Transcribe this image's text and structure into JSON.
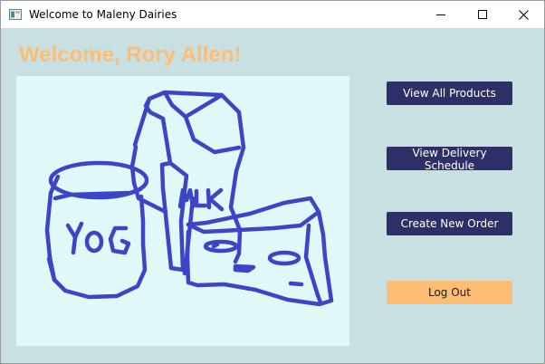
{
  "window": {
    "title": "Welcome to Maleny Dairies",
    "controls": [
      "minimize-icon",
      "maximize-icon",
      "close-icon"
    ]
  },
  "welcome_text": "Welcome, Rory Allen!",
  "illustration": {
    "labels": [
      "MLK",
      "YoG"
    ],
    "icon": "dairy-products-drawing"
  },
  "buttons": {
    "view_all_products": "View All Products",
    "view_delivery_schedule": "View Delivery Schedule",
    "create_new_order": "Create New Order",
    "log_out": "Log Out"
  },
  "colors": {
    "background": "#c8e0e1",
    "accent": "#ffbd73",
    "button": "#2e2f67",
    "drawing_panel": "#e0f8f8",
    "drawing_ink": "#3c45c8"
  }
}
